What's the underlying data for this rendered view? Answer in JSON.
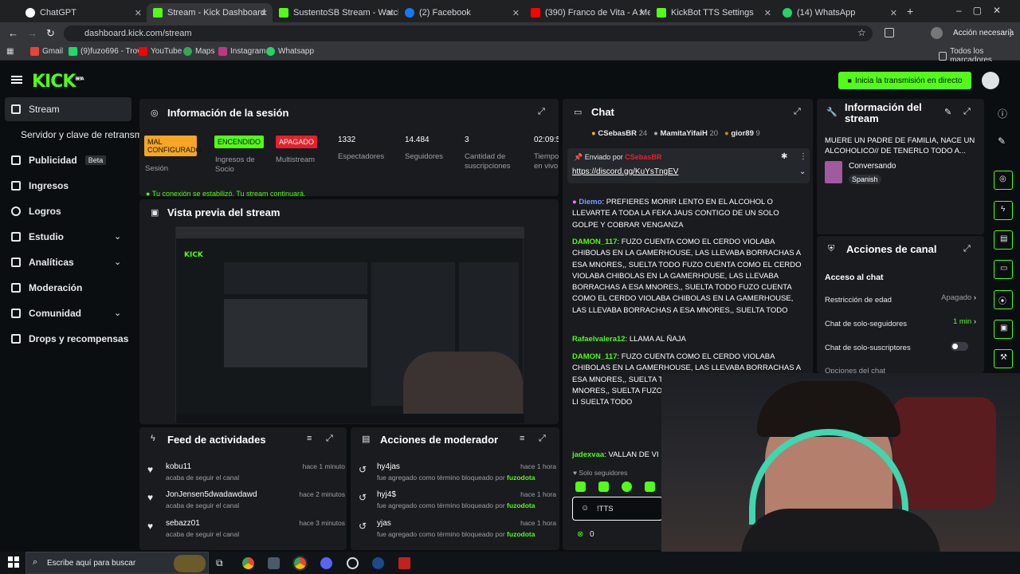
{
  "browser": {
    "tabs": [
      "ChatGPT",
      "Stream - Kick Dashboard",
      "SustentoSB Stream - Watch Li",
      "(2) Facebook",
      "(390) Franco de Vita - A Medio",
      "KickBot TTS Settings",
      "(14) WhatsApp"
    ],
    "url": "dashboard.kick.com/stream",
    "profile_button": "Acción necesaria",
    "bookmarks": [
      "Gmail",
      "(9)fuzo696 - Trovo",
      "YouTube",
      "Maps",
      "Instagram",
      "Whatsapp"
    ],
    "all_bookmarks": "Todos los marcadores"
  },
  "header": {
    "logo": "KICK",
    "beta": "BETA",
    "go_live": "Inicia la transmisión en directo"
  },
  "sidebar": {
    "items": [
      {
        "label": "Stream"
      },
      {
        "label": "Servidor y clave de retransm"
      },
      {
        "label": "Publicidad",
        "badge": "Beta"
      },
      {
        "label": "Ingresos"
      },
      {
        "label": "Logros"
      },
      {
        "label": "Estudio"
      },
      {
        "label": "Analíticas"
      },
      {
        "label": "Moderación"
      },
      {
        "label": "Comunidad"
      },
      {
        "label": "Drops y recompensas"
      }
    ]
  },
  "session": {
    "title": "Información de la sesión",
    "session_badge": "MAL CONFIGURADO",
    "session_label": "Sesión",
    "on_badge": "ENCENDIDO",
    "on_label": "Ingresos de Socio",
    "off_badge": "APAGADO",
    "off_label": "Multistream",
    "viewers": "1332",
    "viewers_label": "Espectadores",
    "followers": "14.484",
    "followers_label": "Seguidores",
    "subs": "3",
    "subs_label": "Cantidad de suscripciones",
    "time": "02:09:5",
    "time_label": "Tiempo en vivo",
    "connection_msg": "Tu conexión se estabilizó. Tu stream continuará."
  },
  "preview": {
    "title": "Vista previa del stream"
  },
  "activity": {
    "title": "Feed de actividades",
    "items": [
      {
        "name": "kobu11",
        "text": "acaba de seguir el canal",
        "time": "hace 1 minuto"
      },
      {
        "name": "JonJensen5dwadawdawd",
        "text": "acaba de seguir el canal",
        "time": "hace 2 minutos"
      },
      {
        "name": "sebazz01",
        "text": "acaba de seguir el canal",
        "time": "hace 3 minutos"
      }
    ]
  },
  "modactions": {
    "title": "Acciones de moderador",
    "items": [
      {
        "name": "hy4jas",
        "text": "fue agregado como término bloqueado por",
        "by": "fuzodota",
        "time": "hace 1 hora"
      },
      {
        "name": "hyj4$",
        "text": "fue agregado como término bloqueado por",
        "by": "fuzodota",
        "time": "hace 1 hora"
      },
      {
        "name": "yjas",
        "text": "fue agregado como término bloqueado por",
        "by": "fuzodota",
        "time": "hace 1 hora"
      }
    ]
  },
  "chat": {
    "title": "Chat",
    "top": [
      {
        "name": "CSebasBR",
        "value": "24"
      },
      {
        "name": "MamitaYifaiH",
        "value": "20"
      },
      {
        "name": "gior89",
        "value": "9"
      }
    ],
    "pinned_by": "Enviado por",
    "pinned_user": "CSebasBR",
    "pinned_link": "https://discord.gg/KuYsTngEV",
    "messages": [
      {
        "user": "Diemo",
        "text": "PREFIERES MORIR LENTO EN EL ALCOHOL O LLEVARTE A TODA LA FEKA JAUS CONTIGO DE UN SOLO GOLPE Y COBRAR VENGANZA"
      },
      {
        "user": "DAMON_117",
        "text": "FUZO CUENTA COMO EL CERDO VIOLABA CHIBOLAS EN LA GAMERHOUSE, LAS LLEVABA BORRACHAS A ESA MNORES,, SUELTA TODO FUZO CUENTA COMO EL CERDO VIOLABA CHIBOLAS EN LA GAMERHOUSE, LAS LLEVABA BORRACHAS A ESA MNORES,, SUELTA TODO FUZO CUENTA COMO EL CERDO VIOLABA CHIBOLAS EN LA GAMERHOUSE, LAS LLEVABA BORRACHAS A ESA MNORES,, SUELTA TODO"
      },
      {
        "user": "Rafaelvalera12",
        "text": "LLAMA AL ÑAJA"
      },
      {
        "user": "DAMON_117",
        "text": "FUZO CUENTA COMO EL CERDO VIOLABA CHIBOLAS EN LA GAMERHOUSE, LAS LLEVABA BORRACHAS A ESA MNORES,, SUELTA T EL CERDO VIOLABA CHIB A ESA MNORES,, SUELTA FUZO CUENTA COM LA GAMERHOUSE, LAS LI SUELTA TODO"
      },
      {
        "user": "jadexvaa",
        "text": "VALLAN DE VI"
      }
    ],
    "followers_only": "Solo seguidores",
    "input_value": "!TTS",
    "points": "0"
  },
  "stream_info": {
    "title": "Información del stream",
    "stream_title": "MUERE UN PADRE DE FAMILIA, NACE UN ALCOHOLICO// DE TENERLO TODO A...",
    "category": "Conversando",
    "language": "Spanish"
  },
  "channel_actions": {
    "title": "Acciones de canal",
    "section": "Acceso al chat",
    "rows": [
      {
        "label": "Restricción de edad",
        "value": "Apagado"
      },
      {
        "label": "Chat de solo-seguidores",
        "value": "1 min"
      },
      {
        "label": "Chat de solo-suscriptores",
        "value": ""
      }
    ],
    "cut_row": "Opciones del chat"
  },
  "taskbar": {
    "search": "Escribe aquí para buscar"
  },
  "colors": {
    "accent": "#53fc18",
    "bg": "#0b0e10",
    "panel": "#191b1f",
    "danger": "#e5202c",
    "warn": "#f6a623"
  }
}
